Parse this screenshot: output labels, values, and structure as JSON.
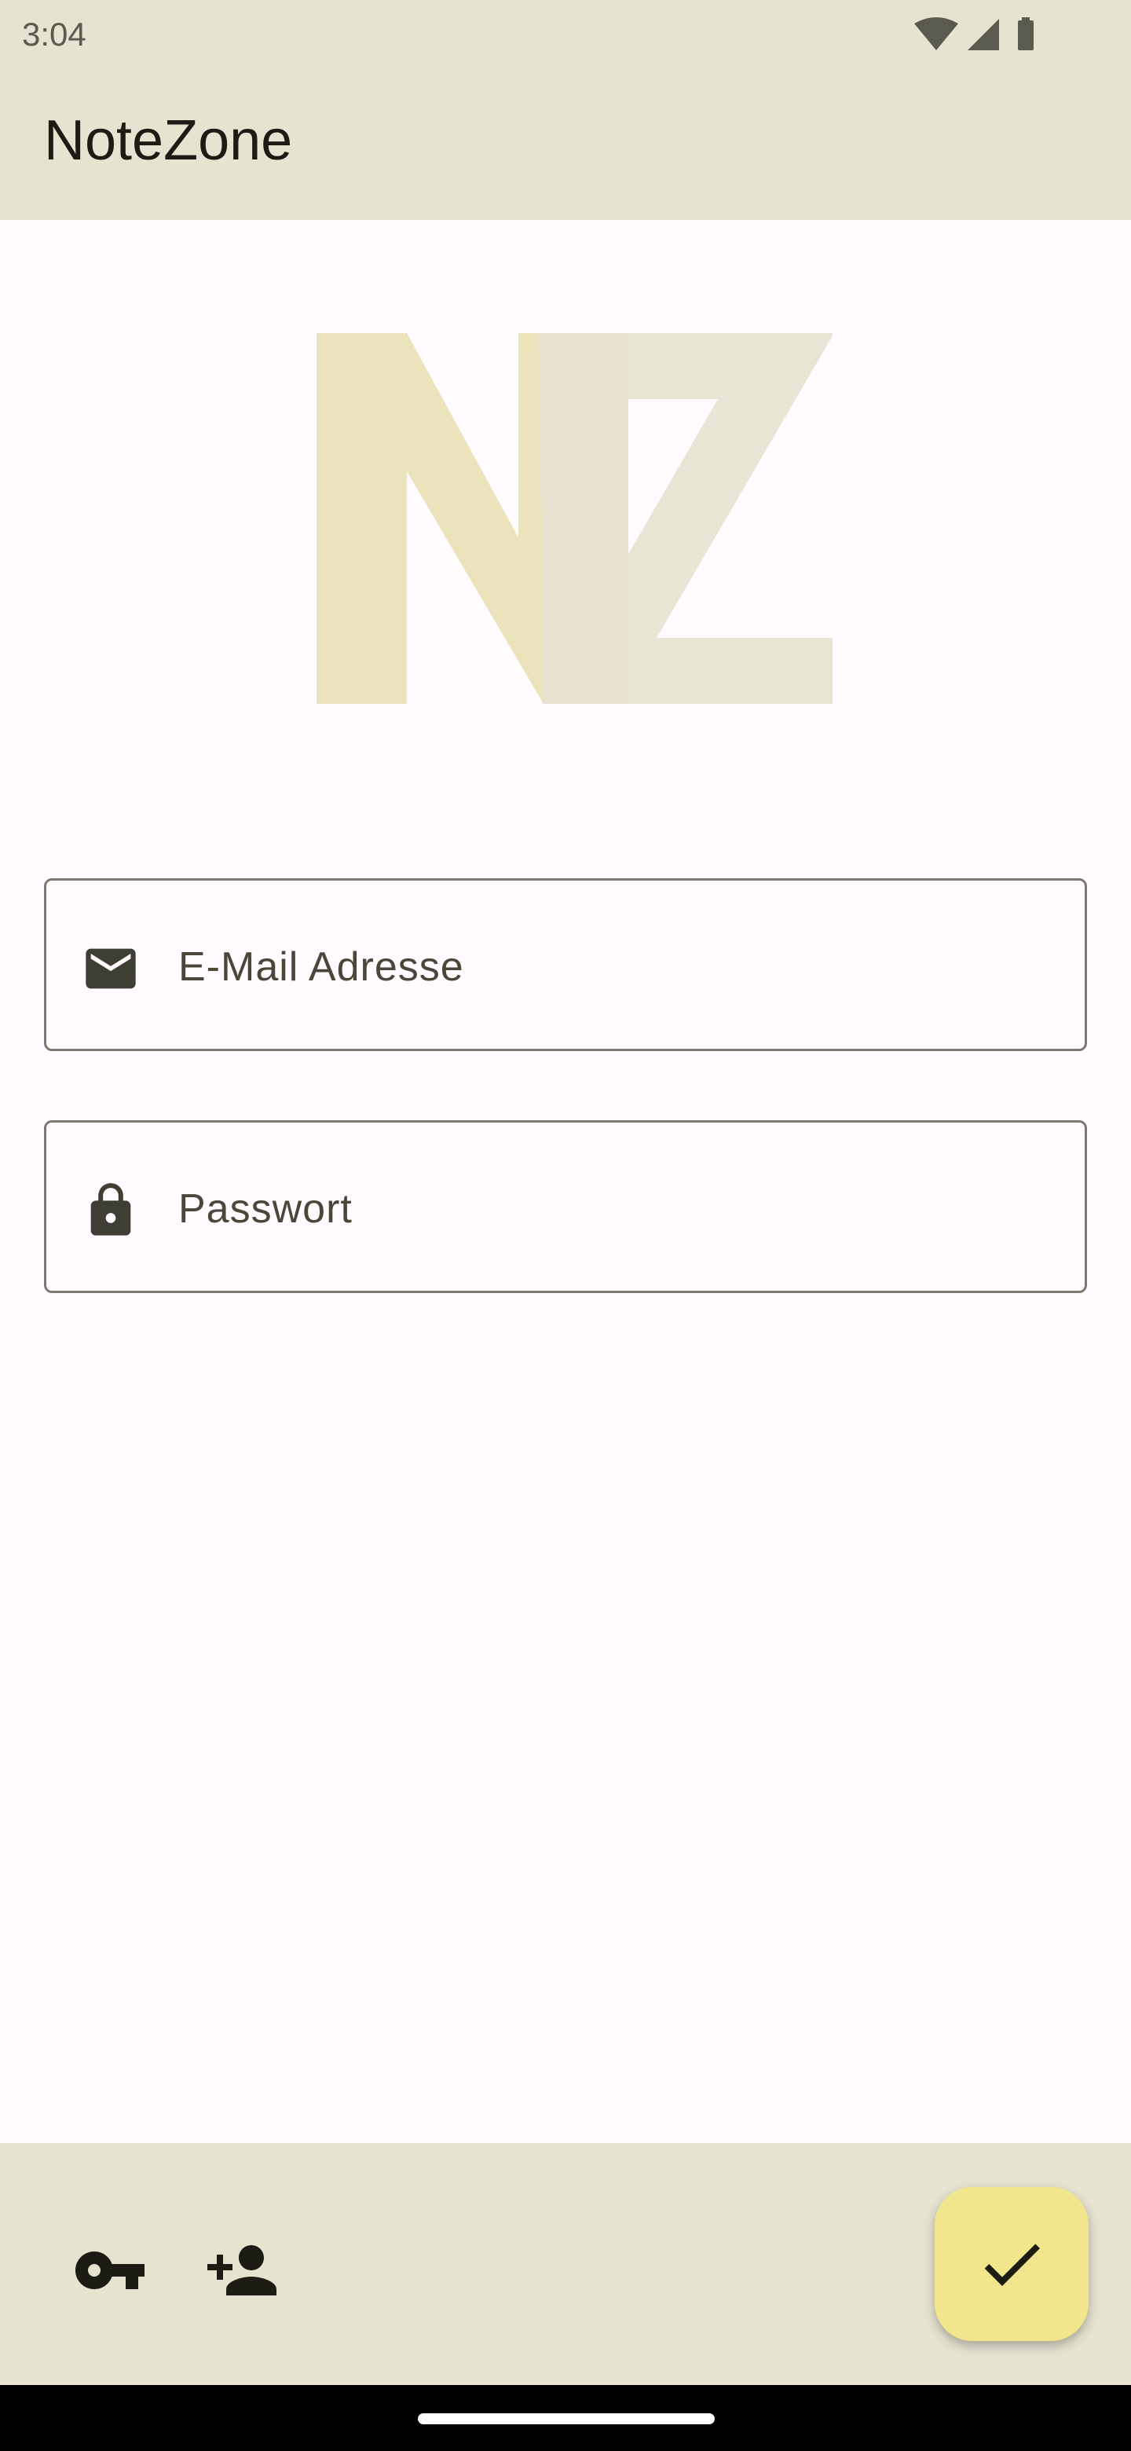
{
  "status_bar": {
    "time": "3:04",
    "icons": [
      "wifi-icon",
      "signal-icon",
      "battery-icon"
    ]
  },
  "app_bar": {
    "title": "NoteZone"
  },
  "logo": {
    "letters": "NZ",
    "colors": {
      "n": "#ebe3bb",
      "z": "#e6e3d1"
    }
  },
  "form": {
    "email": {
      "icon": "mail-icon",
      "placeholder": "E-Mail Adresse",
      "value": ""
    },
    "password": {
      "icon": "lock-icon",
      "placeholder": "Passwort",
      "value": ""
    }
  },
  "bottom_bar": {
    "actions": [
      {
        "icon": "key-icon"
      },
      {
        "icon": "person-add-icon"
      }
    ],
    "fab": {
      "icon": "check-icon",
      "color": "#f2e68c"
    }
  },
  "colors": {
    "bar_background": "#e6e3d1",
    "page_background": "#fffbfe",
    "icon": "#1d1c14",
    "outline": "#7a796d"
  }
}
